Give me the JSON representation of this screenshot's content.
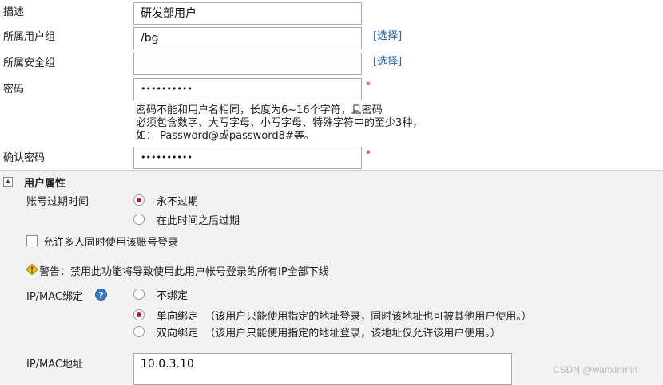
{
  "form": {
    "description": {
      "label": "描述",
      "value": "研发部用户"
    },
    "user_group": {
      "label": "所属用户组",
      "value": "/bg",
      "select_link": "[选择]"
    },
    "security_group": {
      "label": "所属安全组",
      "value": "",
      "select_link": "[选择]"
    },
    "password": {
      "label": "密码",
      "value": "••••••••••",
      "required_mark": "*"
    },
    "password_hint": {
      "line1": "密码不能和用户名相同，长度为6~16个字符，且密码",
      "line2": "必须包含数字、大写字母、小写字母、特殊字符中的至少3种，",
      "line3": "如：  Password@或password8#等。"
    },
    "confirm_password": {
      "label": "确认密码",
      "value": "••••••••••",
      "required_mark": "*"
    }
  },
  "user_attributes": {
    "title": "用户属性",
    "expiry": {
      "label": "账号过期时间",
      "options": [
        {
          "label": "永不过期",
          "selected": true
        },
        {
          "label": "在此时间之后过期",
          "selected": false
        }
      ]
    },
    "multi_login": {
      "label": "允许多人同时使用该账号登录",
      "checked": false
    },
    "warning": {
      "text": "警告：禁用此功能将导致使用此用户帐号登录的所有IP全部下线"
    },
    "ipmac_binding": {
      "label": "IP/MAC绑定",
      "help_glyph": "?",
      "options": [
        {
          "label": "不绑定",
          "selected": false
        },
        {
          "label": "单向绑定  （该用户只能使用指定的地址登录，同时该地址也可被其他用户使用。）",
          "selected": true
        },
        {
          "label": "双向绑定  （该用户只能使用指定的地址登录，该地址仅允许该用户使用。）",
          "selected": false
        }
      ]
    },
    "ipmac_address": {
      "label": "IP/MAC地址",
      "value": "10.0.3.10"
    }
  },
  "watermark": "CSDN @wanxinmin",
  "colors": {
    "accent_radio": "#b01e2b",
    "link": "#1f5fbf",
    "required": "#dd0000",
    "section_bg": "#f2f2f2"
  }
}
